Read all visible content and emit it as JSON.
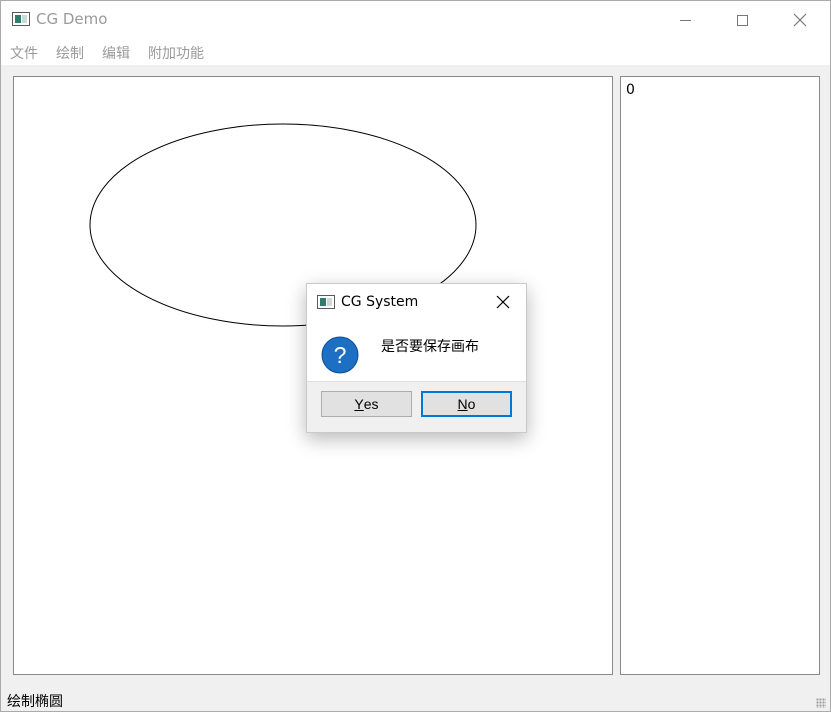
{
  "window": {
    "title": "CG Demo",
    "min_icon": "minimize-icon",
    "max_icon": "maximize-icon",
    "close_icon": "close-icon"
  },
  "menu": {
    "items": [
      "文件",
      "绘制",
      "编辑",
      "附加功能"
    ]
  },
  "canvas": {
    "shapes": [
      {
        "type": "ellipse",
        "stroke": "#000000"
      }
    ]
  },
  "side_list": {
    "items": [
      "0"
    ]
  },
  "status": {
    "text": "绘制椭圆"
  },
  "dialog": {
    "title": "CG System",
    "message": "是否要保存画布",
    "icon": "question-icon",
    "yes_mnemonic": "Y",
    "yes_rest": "es",
    "no_mnemonic": "N",
    "no_rest": "o"
  },
  "colors": {
    "accent": "#0078d7",
    "question_icon": "#1c6fc3"
  }
}
